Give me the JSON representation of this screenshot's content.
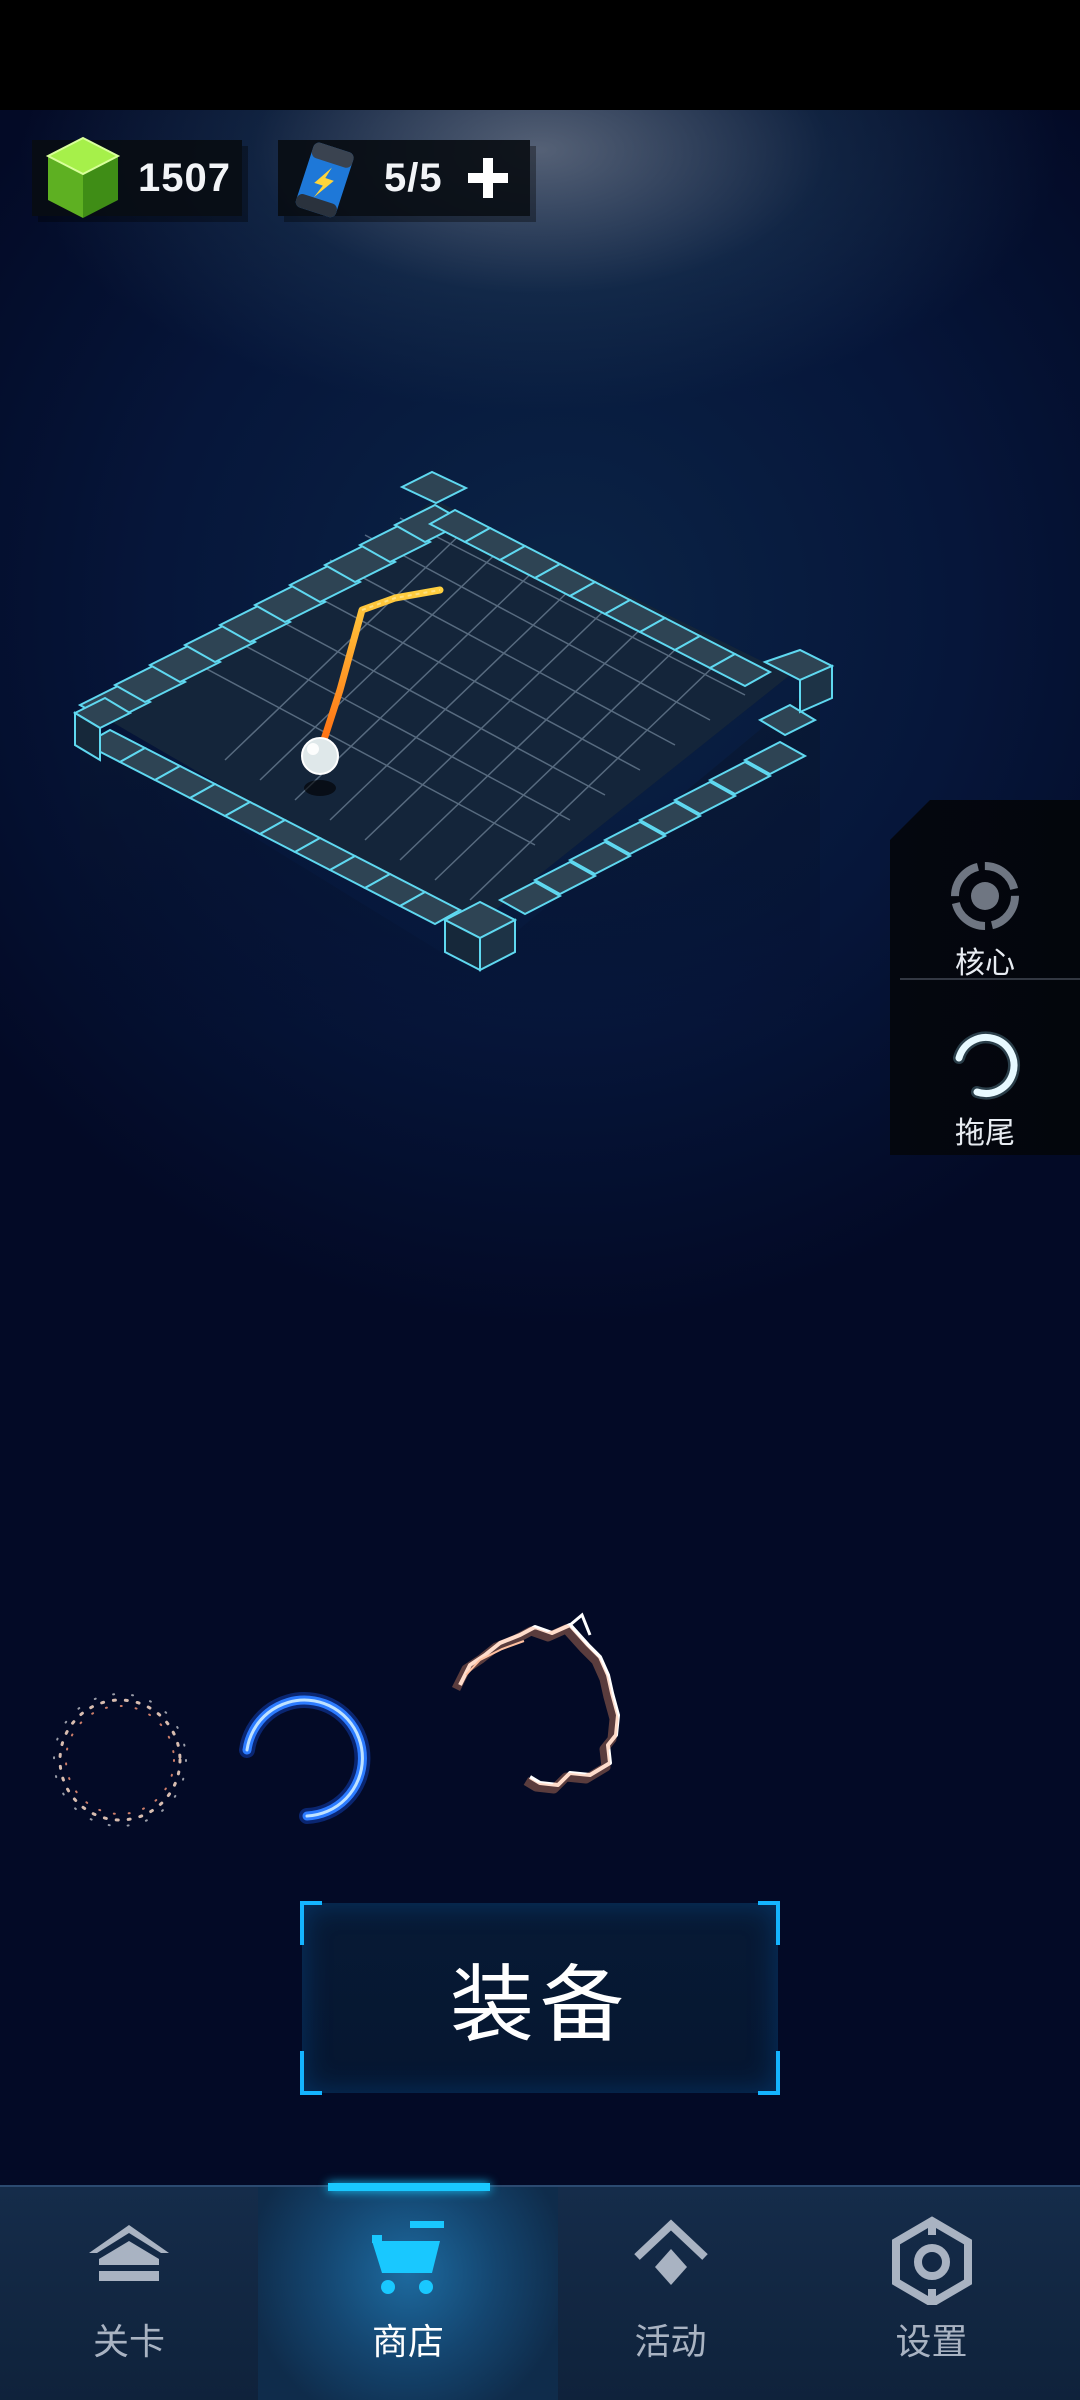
{
  "resources": {
    "gems": "1507",
    "energy": "5/5"
  },
  "side_panel": {
    "tabs": [
      {
        "label": "核心",
        "icon": "core-ring-icon"
      },
      {
        "label": "拖尾",
        "icon": "trail-ring-icon"
      }
    ]
  },
  "trails": [
    {
      "name": "sparkle-trail",
      "icon": "sparkle-ring"
    },
    {
      "name": "blue-arc-trail",
      "icon": "blue-arc"
    },
    {
      "name": "lightning-trail",
      "icon": "lightning-ring"
    }
  ],
  "equip_button": {
    "label": "装备"
  },
  "bottom_nav": {
    "items": [
      {
        "label": "关卡",
        "icon": "home-icon",
        "active": false
      },
      {
        "label": "商店",
        "icon": "cart-icon",
        "active": true
      },
      {
        "label": "活动",
        "icon": "diamond-icon",
        "active": false
      },
      {
        "label": "设置",
        "icon": "gear-icon",
        "active": false
      }
    ]
  },
  "colors": {
    "accent": "#19c8ff",
    "trail_orange": "#ffb020",
    "background": "#030a26",
    "nav_background": "#152c4a"
  }
}
